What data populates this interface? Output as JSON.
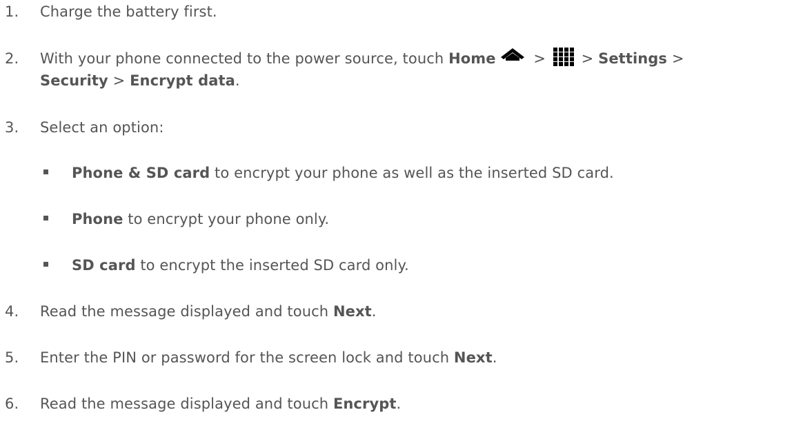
{
  "steps": [
    {
      "num": "1.",
      "text": "Charge the battery first."
    },
    {
      "num": "2.",
      "pre": "With your phone connected to the power source, touch ",
      "home": "Home",
      "sep1": " > ",
      "sep2": " > ",
      "settings": "Settings",
      "sep3": " >",
      "security": "Security",
      "sep4": " > ",
      "encrypt_data": "Encrypt data",
      "end": "."
    },
    {
      "num": "3.",
      "text": "Select an option:"
    },
    {
      "num": "4.",
      "pre": "Read the message displayed and touch ",
      "bold": "Next",
      "end": "."
    },
    {
      "num": "5.",
      "pre": "Enter the PIN or password for the screen lock and touch ",
      "bold": "Next",
      "end": "."
    },
    {
      "num": "6.",
      "pre": "Read the message displayed and touch ",
      "bold": "Encrypt",
      "end": "."
    }
  ],
  "options": [
    {
      "bold": "Phone & SD card",
      "rest": " to encrypt your phone as well as the inserted SD card."
    },
    {
      "bold": "Phone",
      "rest": " to encrypt your phone only."
    },
    {
      "bold": "SD card",
      "rest": " to encrypt the inserted SD card only."
    }
  ],
  "icons": {
    "home": "home-icon",
    "apps": "apps-grid-icon"
  },
  "colors": {
    "text": "#555555",
    "icon": "#000000"
  }
}
